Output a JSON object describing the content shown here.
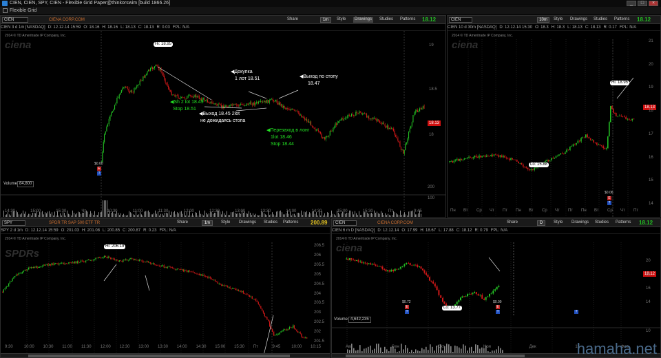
{
  "window": {
    "title": "CIEN, CIEN, SPY, CIEN - Flexible Grid Paper@thinkorswim [build 1866.26]",
    "min": "_",
    "max": "□",
    "close": "×"
  },
  "menu": {
    "label": "Flexible Grid"
  },
  "toolbar_common": {
    "share": "Share",
    "style": "Style",
    "drawings": "Drawings",
    "studies": "Studies",
    "patterns": "Patterns"
  },
  "colors": {
    "up": "#23c023",
    "down": "#d01818",
    "accent": "#d07030",
    "price_tag": "#d01010"
  },
  "p1": {
    "symbol": "CIEN",
    "desc": "CIENA CORP.COM",
    "timeframe": "1m",
    "price": "18.12",
    "price_color": "#23c023",
    "info": [
      "CIEN 3 d 1m [NASDAQ]",
      "D: 12.12.14 15:59",
      "O: 18.16",
      "H: 18.16",
      "L: 18.13",
      "C: 18.13",
      "R: 0.03",
      "FPL: N/A"
    ],
    "watermark": "ciena",
    "copyright": "2014 © TD Ameritrade IP Company, Inc.",
    "hi_label": "Hi: 18.95",
    "tag": "18.13",
    "notes": {
      "buy1": "Докупка",
      "buy2": "1 лот 18.51",
      "exit1": "Выход по стопу",
      "exit2": "18.47",
      "sh1": "Sh 2 lot 18.49",
      "sh2": "Stop 18.51",
      "ex1": "Выход 18.45 2lot",
      "ex2": "не дожидаясь стопа",
      "re1": "Перезаход в лонг",
      "re2": "1lot 18.46",
      "re3": "Stop 18.44"
    },
    "y_ticks": [
      "19",
      "18.5",
      "18"
    ],
    "x_ticks": [
      "14:30",
      "15:00",
      "15:30",
      "Чт",
      "10:30",
      "11:00",
      "11:30",
      "12:00",
      "12:30",
      "13:00",
      "13:30",
      "14:00",
      "14:30",
      "15:00",
      "15:30",
      "Пт",
      "9:45"
    ],
    "event_price": "$0.00",
    "volume_label": "Volume",
    "volume_value": "84,800",
    "vol_ticks": [
      "200",
      "100"
    ]
  },
  "p2": {
    "symbol": "CIEN",
    "timeframe": "10m",
    "price": "18.12",
    "price_color": "#23c023",
    "info": [
      "CIEN 10 d 30m [NASDAQ]",
      "D: 12.12.14 15:30",
      "O: 18.3",
      "H: 18.3",
      "L: 18.13",
      "C: 18.13",
      "R: 0.17",
      "FPL: N/A"
    ],
    "watermark": "ciena",
    "copyright": "2014 © TD Ameritrade IP Company, Inc.",
    "hi_label": "Hi: 18.95",
    "lo_label": "Lo: 15.88",
    "tag": "18.13",
    "event_price": "$0.06",
    "y_ticks": [
      "21",
      "20",
      "19",
      "18",
      "17",
      "16",
      "15",
      "14"
    ],
    "x_ticks": [
      "Пн",
      "Вт",
      "Ср",
      "Чт",
      "Пт",
      "Пн",
      "Вт",
      "Ср",
      "Чт",
      "Пт",
      "Пн",
      "Вт",
      "Ср",
      "Чт",
      "Пт"
    ]
  },
  "p3": {
    "symbol": "SPY",
    "desc": "SPDR TR SAP 500 ETF TR",
    "timeframe": "1m",
    "price": "200.89",
    "price_color": "#e0c020",
    "info": [
      "SPY 2 d 1m",
      "D: 12.12.14 15:59",
      "O: 201.03",
      "H: 201.08",
      "L: 200.85",
      "C: 200.87",
      "R: 0.23",
      "FPL: N/A"
    ],
    "watermark": "SPDRs",
    "copyright": "2014 © TD Ameritrade IP Company, Inc.",
    "hi_label": "Hi: 206.19",
    "y_ticks": [
      "206.5",
      "206",
      "205.5",
      "205",
      "204.5",
      "204",
      "203.5",
      "203",
      "202.5",
      "202",
      "201.5"
    ],
    "x_ticks": [
      "9:30",
      "10:00",
      "10:30",
      "11:00",
      "11:30",
      "12:00",
      "12:30",
      "13:00",
      "13:30",
      "14:00",
      "14:30",
      "15:00",
      "15:30",
      "Пт",
      "9:45",
      "10:00",
      "10:15"
    ]
  },
  "p4": {
    "symbol": "CIEN",
    "desc": "CIENA CORP.COM",
    "timeframe": "D",
    "price": "18.12",
    "price_color": "#23c023",
    "info": [
      "CIEN 6 m D [NASDAQ]",
      "D: 12.12.14",
      "O: 17.99",
      "H: 18.67",
      "L: 17.88",
      "C: 18.12",
      "R: 0.79",
      "FPL: N/A"
    ],
    "watermark": "ciena",
    "copyright": "2014 © TD Ameritrade IP Company, Inc.",
    "lo_label": "Lo: 13.77",
    "tag": "18.12",
    "events": [
      "$0.72",
      "$0.09"
    ],
    "y_ticks": [
      "20",
      "18",
      "16",
      "14"
    ],
    "x_ticks": [
      "Авг",
      "Сен",
      "Окт",
      "Ноя",
      "Дек",
      "15",
      "Фев"
    ],
    "volume_label": "Volume",
    "volume_value": "4,642,235",
    "vol_ticks": [
      "10"
    ]
  },
  "site": "hamaha.net"
}
